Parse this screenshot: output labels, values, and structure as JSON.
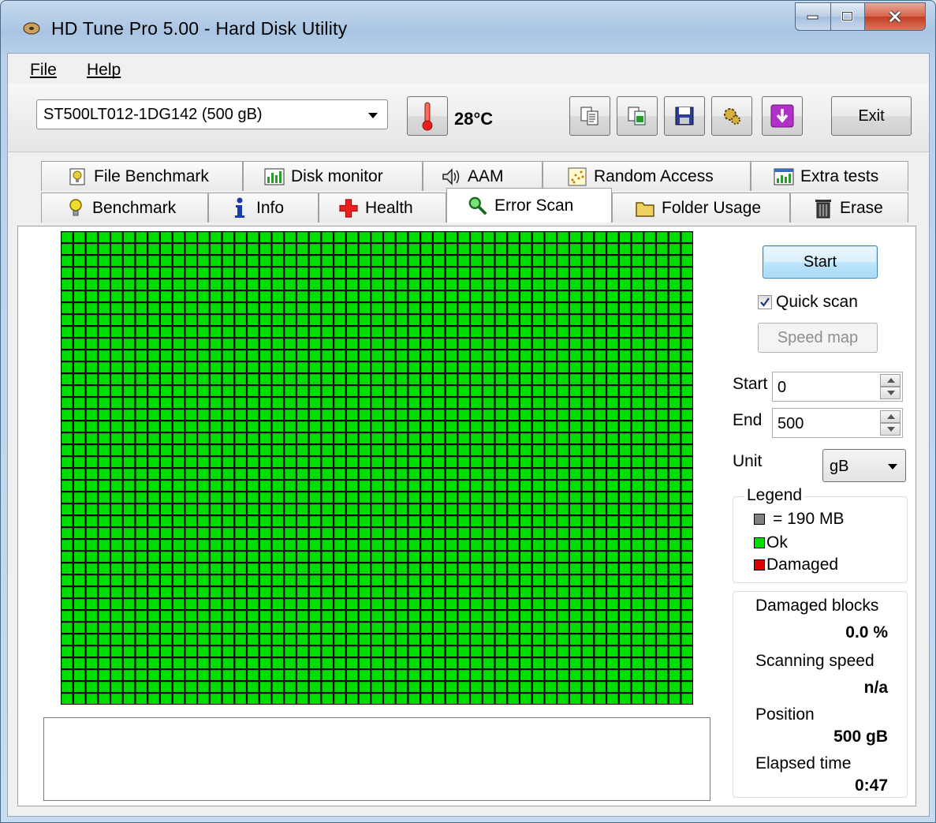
{
  "window": {
    "title": "HD Tune Pro 5.00 - Hard Disk Utility"
  },
  "menu": {
    "file": "File",
    "help": "Help"
  },
  "toolbar": {
    "drive": "ST500LT012-1DG142 (500 gB)",
    "temperature": "28°C",
    "exit_label": "Exit"
  },
  "tabs": {
    "row1": [
      "File Benchmark",
      "Disk monitor",
      "AAM",
      "Random Access",
      "Extra tests"
    ],
    "row2": [
      "Benchmark",
      "Info",
      "Health",
      "Error Scan",
      "Folder Usage",
      "Erase"
    ],
    "active": "Error Scan"
  },
  "scan": {
    "start_label": "Start",
    "quick_scan_label": "Quick scan",
    "quick_scan_checked": true,
    "speed_map_label": "Speed map",
    "start_field_label": "Start",
    "start_value": "0",
    "end_field_label": "End",
    "end_value": "500",
    "unit_label": "Unit",
    "unit_value": "gB"
  },
  "legend": {
    "title": "Legend",
    "block_size": "= 190 MB",
    "ok": "Ok",
    "damaged": "Damaged"
  },
  "stats": {
    "damaged_blocks_label": "Damaged blocks",
    "damaged_blocks_value": "0.0 %",
    "scanning_speed_label": "Scanning speed",
    "scanning_speed_value": "n/a",
    "position_label": "Position",
    "position_value": "500 gB",
    "elapsed_label": "Elapsed time",
    "elapsed_value": "0:47"
  },
  "colors": {
    "ok": "#00dd00",
    "damaged": "#dd0000",
    "block": "#808080",
    "accent": "#3c7fb1"
  },
  "block_map": {
    "columns": 51,
    "rows": 40,
    "ok_blocks": 2040,
    "damaged_blocks": 0
  }
}
